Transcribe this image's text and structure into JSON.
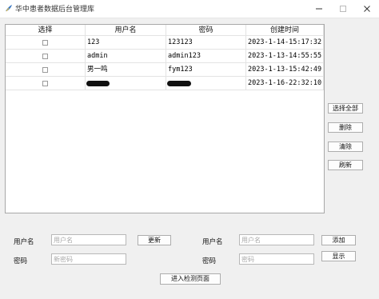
{
  "window": {
    "title": "华中患者数据后台管理库",
    "icon": "python-feather-icon"
  },
  "table": {
    "columns": [
      "选择",
      "用户名",
      "密码",
      "创建时间"
    ],
    "rows": [
      {
        "username": "123",
        "password": "123123",
        "created": "2023-1-14-15:17:32",
        "redacted_user": false,
        "redacted_pass": false
      },
      {
        "username": "admin",
        "password": "admin123",
        "created": "2023-1-13-14:55:55",
        "redacted_user": false,
        "redacted_pass": false
      },
      {
        "username": "男一鸣",
        "password": "fym123",
        "created": "2023-1-13-15:42:49",
        "redacted_user": false,
        "redacted_pass": false
      },
      {
        "username": "",
        "password": "",
        "created": "2023-1-16-22:32:10",
        "redacted_user": true,
        "redacted_pass": true
      }
    ]
  },
  "side_buttons": {
    "select_all": "选择全部",
    "delete": "删除",
    "clear": "清除",
    "refresh": "刷新"
  },
  "form": {
    "left": {
      "username_label": "用户名",
      "username_placeholder": "用户名",
      "password_label": "密码",
      "password_placeholder": "新密码",
      "update_button": "更新"
    },
    "right": {
      "username_label": "用户名",
      "username_placeholder": "用户名",
      "password_label": "密码",
      "password_placeholder": "密码",
      "add_button": "添加",
      "show_button": "显示"
    },
    "enter_detection_button": "进入检测页面"
  }
}
